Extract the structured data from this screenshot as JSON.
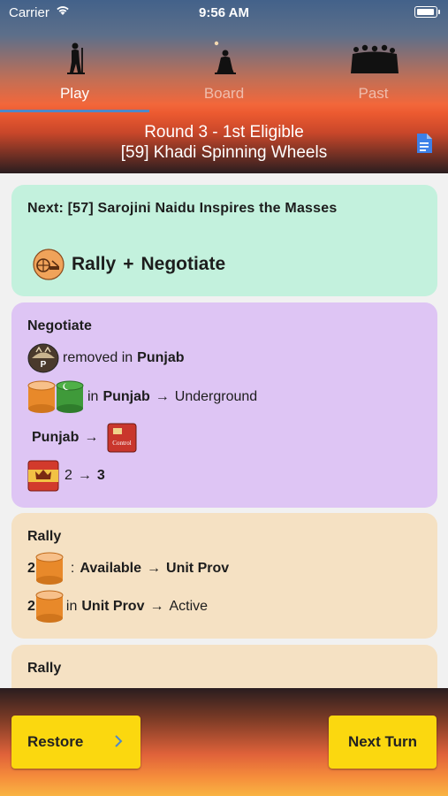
{
  "status_bar": {
    "carrier": "Carrier",
    "time": "9:56 AM"
  },
  "tabs": [
    {
      "label": "Play",
      "active": true
    },
    {
      "label": "Board",
      "active": false
    },
    {
      "label": "Past",
      "active": false
    }
  ],
  "round": {
    "line1": "Round 3 - 1st Eligible",
    "line2": "[59] Khadi Spinning Wheels"
  },
  "next_card": {
    "title": "Next: [57] Sarojini Naidu Inspires the Masses",
    "ops_a": "Rally",
    "ops_plus": "+",
    "ops_b": "Negotiate"
  },
  "negotiate": {
    "title": "Negotiate",
    "row1": {
      "text": "removed in",
      "place": "Punjab",
      "badge": "P"
    },
    "row2": {
      "in": "in",
      "place": "Punjab",
      "arrow": "→",
      "result": "Underground"
    },
    "row3": {
      "place": "Punjab",
      "arrow": "→",
      "badge_text": "Control"
    },
    "row4": {
      "from": "2",
      "arrow": "→",
      "to": "3"
    }
  },
  "rally": {
    "title": "Rally",
    "row1": {
      "count": "2",
      "colon": ":",
      "src": "Available",
      "arrow": "→",
      "dest": "Unit Prov"
    },
    "row2": {
      "count": "2",
      "in": "in",
      "place": "Unit Prov",
      "arrow": "→",
      "result": "Active"
    }
  },
  "rally2": {
    "title": "Rally"
  },
  "buttons": {
    "restore": "Restore",
    "next_turn": "Next Turn"
  },
  "colors": {
    "accent_blue": "#4e88c8",
    "button_yellow": "#fbd80f",
    "next_card_bg": "#c3f1dd",
    "negotiate_bg": "#dec5f4",
    "rally_bg": "#f5e1c3"
  }
}
